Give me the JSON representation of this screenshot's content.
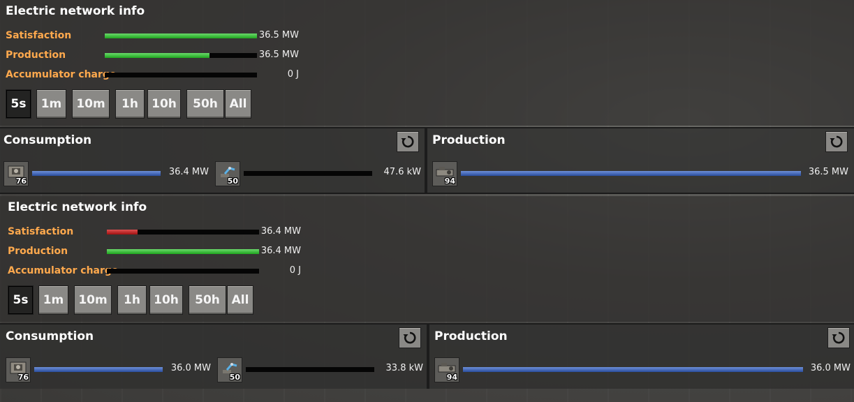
{
  "panels": [
    {
      "title": "Electric network info",
      "satisfaction": {
        "label": "Satisfaction",
        "value": "36.5 MW",
        "fraction": 1.0,
        "color": "#1ea51e"
      },
      "production": {
        "label": "Production",
        "value": "36.5 MW",
        "fraction": 0.69,
        "color": "#1ea51e"
      },
      "accumulator": {
        "label": "Accumulator charge",
        "value": "0 J",
        "fraction": 0.0
      },
      "time_buttons": [
        "5s",
        "1m",
        "10m",
        "1h",
        "10h",
        "50h",
        "All"
      ],
      "active_time": "5s",
      "consumption": {
        "title": "Consumption",
        "entries": [
          {
            "icon": "assembler-icon",
            "count": "76",
            "value": "36.4 MW",
            "fraction": 1.0
          },
          {
            "icon": "inserter-icon",
            "count": "50",
            "value": "47.6 kW",
            "fraction": 0.0
          }
        ]
      },
      "production_section": {
        "title": "Production",
        "entries": [
          {
            "icon": "steam-engine-icon",
            "count": "94",
            "value": "36.5 MW",
            "fraction": 1.0
          }
        ]
      }
    },
    {
      "title": "Electric network info",
      "satisfaction": {
        "label": "Satisfaction",
        "value": "36.4 MW",
        "fraction": 0.2,
        "color": "#a11010"
      },
      "production": {
        "label": "Production",
        "value": "36.4 MW",
        "fraction": 1.0,
        "color": "#1ea51e"
      },
      "accumulator": {
        "label": "Accumulator charge",
        "value": "0 J",
        "fraction": 0.0
      },
      "time_buttons": [
        "5s",
        "1m",
        "10m",
        "1h",
        "10h",
        "50h",
        "All"
      ],
      "active_time": "5s",
      "consumption": {
        "title": "Consumption",
        "entries": [
          {
            "icon": "assembler-icon",
            "count": "76",
            "value": "36.0 MW",
            "fraction": 1.0
          },
          {
            "icon": "inserter-icon",
            "count": "50",
            "value": "33.8 kW",
            "fraction": 0.0
          }
        ]
      },
      "production_section": {
        "title": "Production",
        "entries": [
          {
            "icon": "steam-engine-icon",
            "count": "94",
            "value": "36.0 MW",
            "fraction": 1.0
          }
        ]
      }
    }
  ]
}
